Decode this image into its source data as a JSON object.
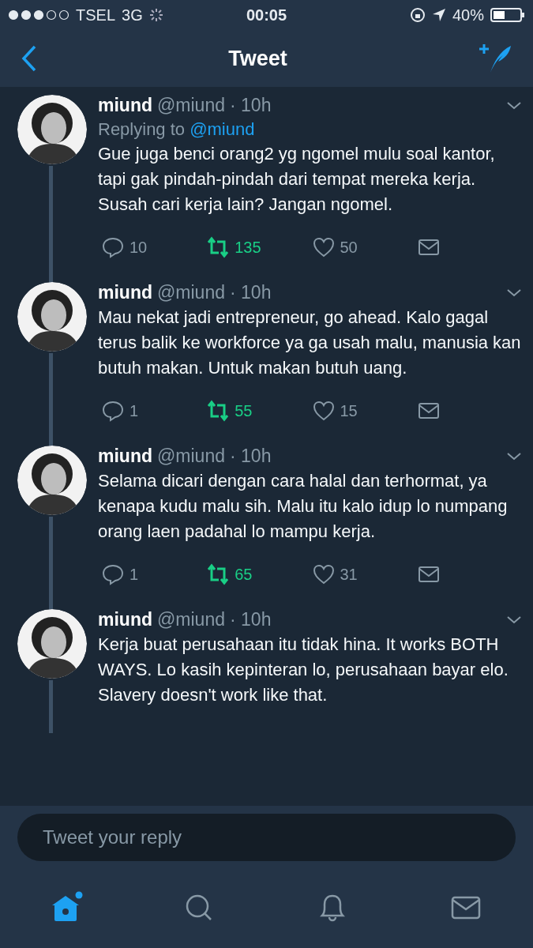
{
  "status_bar": {
    "carrier": "TSEL",
    "network": "3G",
    "time": "00:05",
    "battery": "40%"
  },
  "nav": {
    "title": "Tweet"
  },
  "tweets": [
    {
      "name": "miund",
      "handle": "@miund",
      "time": "· 10h",
      "reply_label": "Replying to",
      "reply_to": "@miund",
      "text": "Gue juga benci orang2 yg ngomel mulu soal kantor, tapi gak pindah-pindah dari tempat mereka kerja. Susah cari kerja lain? Jangan ngomel.",
      "actions": {
        "replies": "10",
        "retweets": "135",
        "retweeted": true,
        "likes": "50",
        "liked": false
      }
    },
    {
      "name": "miund",
      "handle": "@miund",
      "time": "· 10h",
      "text": "Mau nekat jadi entrepreneur, go ahead. Kalo gagal terus balik ke workforce ya ga usah malu, manusia kan butuh makan. Untuk makan butuh uang.",
      "actions": {
        "replies": "1",
        "retweets": "55",
        "retweeted": true,
        "likes": "15",
        "liked": false
      }
    },
    {
      "name": "miund",
      "handle": "@miund",
      "time": "· 10h",
      "text": "Selama dicari dengan cara halal dan terhormat, ya kenapa kudu malu sih. Malu itu kalo idup lo numpang orang laen padahal lo mampu kerja.",
      "actions": {
        "replies": "1",
        "retweets": "65",
        "retweeted": true,
        "likes": "31",
        "liked": false
      }
    },
    {
      "name": "miund",
      "handle": "@miund",
      "time": "· 10h",
      "text": "Kerja buat perusahaan itu tidak hina. It works BOTH WAYS. Lo kasih kepinteran lo, perusahaan bayar elo. Slavery doesn't work like that."
    }
  ],
  "reply_box": {
    "placeholder": "Tweet your reply"
  },
  "tab_bar": [
    {
      "kind": "home",
      "selected": true,
      "unread": true
    },
    {
      "kind": "search",
      "selected": false,
      "unread": false
    },
    {
      "kind": "notifications",
      "selected": false,
      "unread": false
    },
    {
      "kind": "messages",
      "selected": false,
      "unread": false
    }
  ]
}
